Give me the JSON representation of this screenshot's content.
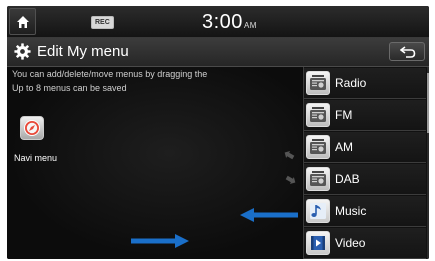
{
  "status_bar": {
    "home_icon": "home-icon",
    "rec_badge": "REC",
    "time": "3:00",
    "ampm": "AM"
  },
  "header": {
    "title": "Edit My menu",
    "title_icon": "gear-icon",
    "back_icon": "back-arrow-icon"
  },
  "instructions": [
    "You can add/delete/move menus by dragging the",
    "Up to 8 menus can be saved"
  ],
  "my_menu": {
    "items": [
      {
        "label": "Navi menu",
        "icon": "compass-icon"
      }
    ]
  },
  "menu_list": {
    "items": [
      {
        "label": "Radio",
        "icon": "radio-icon"
      },
      {
        "label": "FM",
        "icon": "radio-icon"
      },
      {
        "label": "AM",
        "icon": "radio-icon"
      },
      {
        "label": "DAB",
        "icon": "radio-icon"
      },
      {
        "label": "Music",
        "icon": "music-icon"
      },
      {
        "label": "Video",
        "icon": "video-icon"
      }
    ]
  },
  "colors": {
    "screen_bg": "#0a0a0a",
    "drag_arrow": "#1a6fc9",
    "text": "#ffffff"
  }
}
